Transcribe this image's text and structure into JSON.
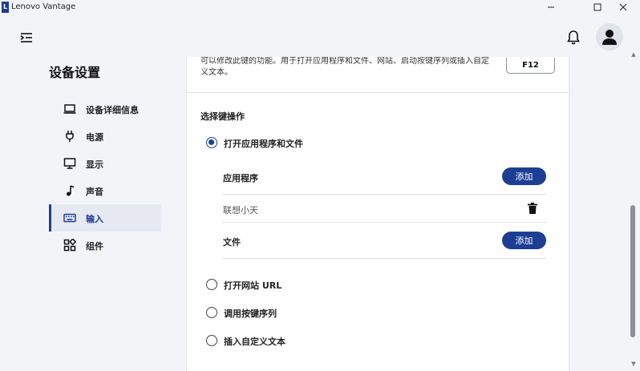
{
  "window": {
    "app_logo_letter": "L",
    "title": "Lenovo Vantage",
    "minimize_glyph": "—",
    "maximize_glyph": "☐",
    "close_glyph": "✕"
  },
  "header": {
    "menu_icon": "menu-collapse-icon",
    "bell_icon": "bell-icon",
    "avatar_icon": "user-icon"
  },
  "sidebar": {
    "title": "设备设置",
    "items": [
      {
        "label": "设备详细信息",
        "icon": "laptop-icon",
        "active": false
      },
      {
        "label": "电源",
        "icon": "plug-icon",
        "active": false
      },
      {
        "label": "显示",
        "icon": "monitor-icon",
        "active": false
      },
      {
        "label": "声音",
        "icon": "music-note-icon",
        "active": false
      },
      {
        "label": "输入",
        "icon": "keyboard-icon",
        "active": true
      },
      {
        "label": "组件",
        "icon": "widgets-icon",
        "active": false
      }
    ]
  },
  "main": {
    "description_line1": "可以修改此键的功能。用于打开应用程序和文件、网站、启动按键序列或插入自定",
    "description_line2": "义文本。",
    "key_label": "F12",
    "section_title": "选择键操作",
    "options": [
      {
        "label": "打开应用程序和文件",
        "checked": true
      },
      {
        "label": "打开网站 URL",
        "checked": false
      },
      {
        "label": "调用按键序列",
        "checked": false
      },
      {
        "label": "插入自定义文本",
        "checked": false
      }
    ],
    "applications_label": "应用程序",
    "add_label": "添加",
    "app_entries": [
      "联想小天"
    ],
    "files_label": "文件"
  },
  "colors": {
    "accent": "#1c3f94",
    "background": "#f3f4f7",
    "panel": "#ffffff"
  }
}
